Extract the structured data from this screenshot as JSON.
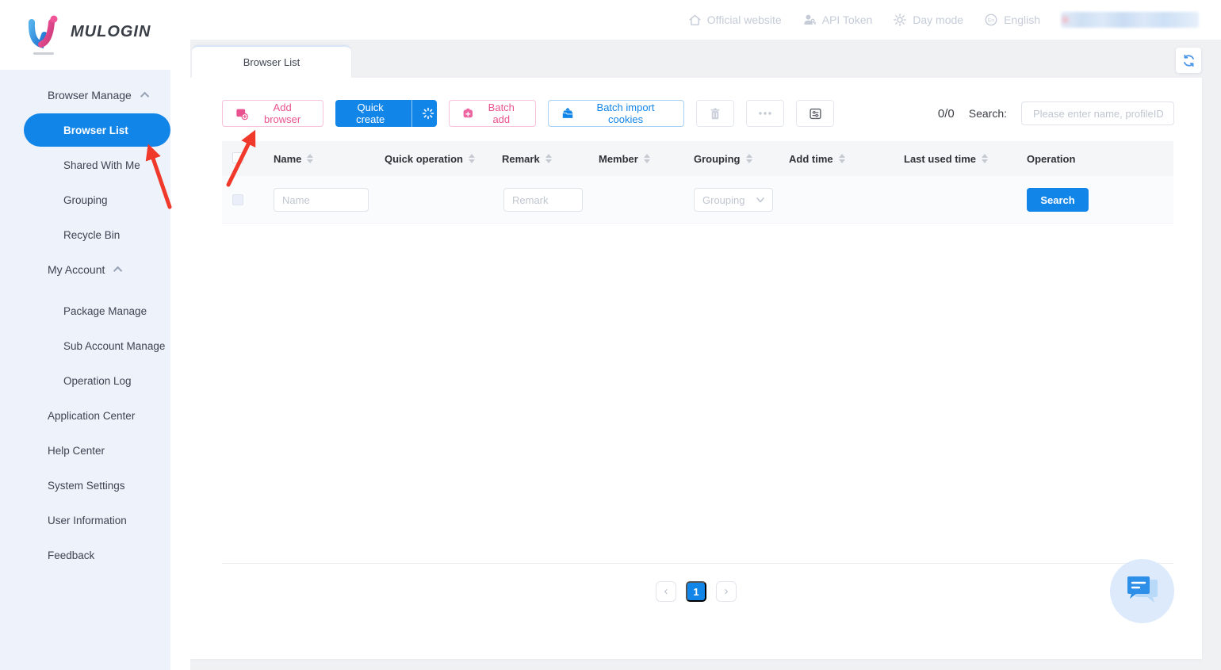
{
  "brand": {
    "name": "MULOGIN"
  },
  "topbar": {
    "items": [
      {
        "label": "Official website",
        "icon": "home-icon"
      },
      {
        "label": "API Token",
        "icon": "user-key-icon"
      },
      {
        "label": "Day mode",
        "icon": "sun-icon"
      },
      {
        "label": "English",
        "icon": "globe-en-icon",
        "icon_text": "En"
      }
    ],
    "account_redacted": true
  },
  "sidebar": {
    "groups": [
      {
        "label": "Browser Manage",
        "expanded": true,
        "items": [
          {
            "label": "Browser List",
            "selected": true
          },
          {
            "label": "Shared With Me"
          },
          {
            "label": "Grouping"
          },
          {
            "label": "Recycle Bin"
          }
        ]
      },
      {
        "label": "My Account",
        "expanded": true,
        "items": [
          {
            "label": "Package Manage"
          },
          {
            "label": "Sub Account Manage"
          },
          {
            "label": "Operation Log"
          }
        ]
      }
    ],
    "links": [
      {
        "label": "Application Center"
      },
      {
        "label": "Help Center"
      },
      {
        "label": "System Settings"
      },
      {
        "label": "User Information"
      },
      {
        "label": "Feedback"
      }
    ]
  },
  "tabs": {
    "active": "Browser List"
  },
  "toolbar": {
    "add_browser": "Add browser",
    "quick_create": "Quick create",
    "batch_add": "Batch add",
    "batch_import_cookies": "Batch import cookies",
    "selection_counter": "0/0",
    "search_label": "Search:",
    "search_placeholder": "Please enter name, profileID"
  },
  "table": {
    "columns": [
      {
        "label": "Name",
        "sortable": true
      },
      {
        "label": "Quick operation",
        "sortable": true
      },
      {
        "label": "Remark",
        "sortable": true
      },
      {
        "label": "Member",
        "sortable": true
      },
      {
        "label": "Grouping",
        "sortable": true
      },
      {
        "label": "Add time",
        "sortable": true
      },
      {
        "label": "Last used time",
        "sortable": true
      },
      {
        "label": "Operation",
        "sortable": false
      }
    ],
    "rows": [],
    "filters": {
      "name_placeholder": "Name",
      "remark_placeholder": "Remark",
      "grouping_placeholder": "Grouping",
      "search_button": "Search"
    }
  },
  "pagination": {
    "prev": "‹",
    "current": "1",
    "next": "›"
  },
  "colors": {
    "primary_blue": "#1285e8",
    "brand_pink": "#e8538f",
    "arrow_red": "#f0382b",
    "sidebar_bg": "#eef2fb",
    "topbar_text": "#c5ccd8"
  }
}
